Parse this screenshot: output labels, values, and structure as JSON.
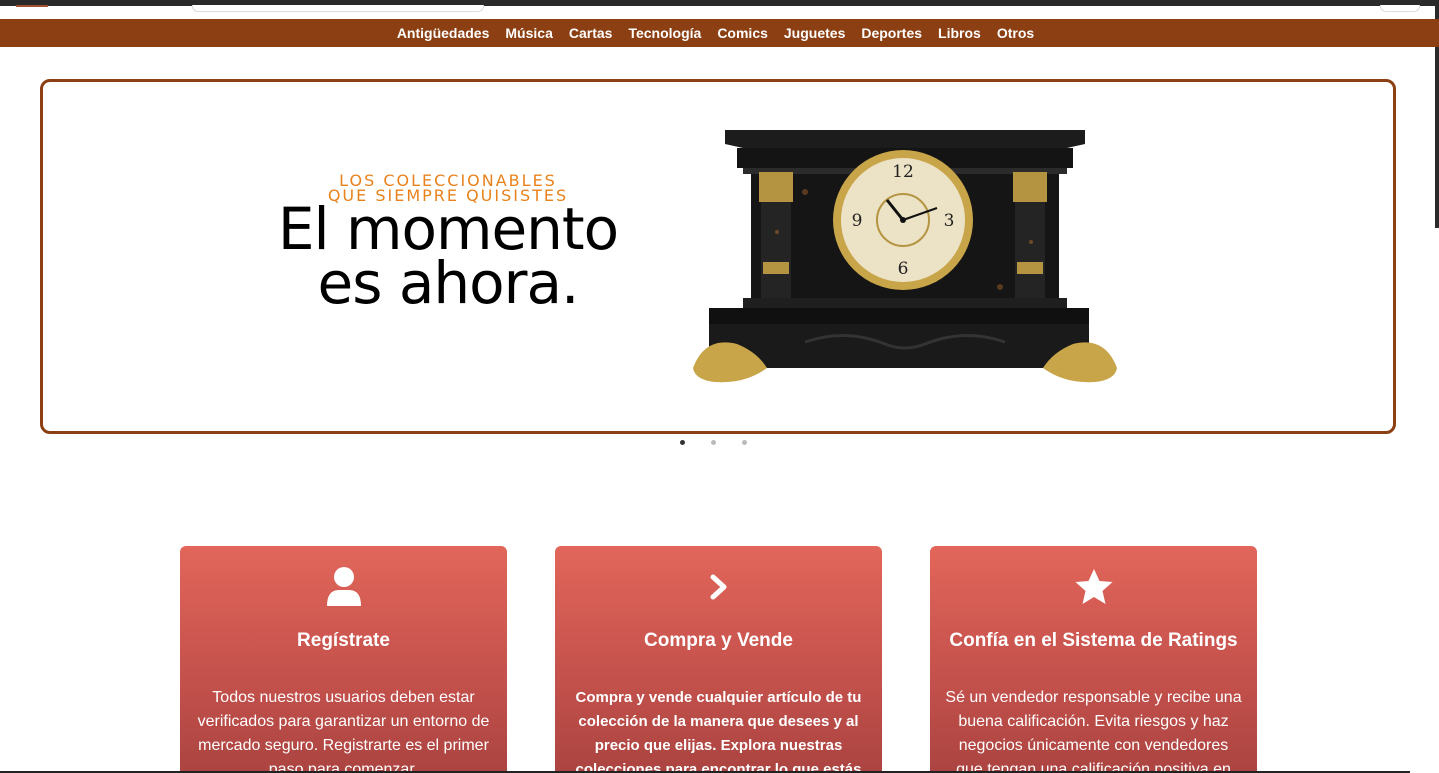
{
  "categories": [
    "Antigüedades",
    "Música",
    "Cartas",
    "Tecnología",
    "Comics",
    "Juguetes",
    "Deportes",
    "Libros",
    "Otros"
  ],
  "hero": {
    "kicker_line1": "LOS COLECCIONABLES",
    "kicker_line2": "QUE SIEMPRE QUISISTES",
    "headline_line1": "El momento",
    "headline_line2": "es ahora.",
    "image": "mantel-clock-image"
  },
  "carousel": {
    "slides": 3,
    "active": 1
  },
  "cards": [
    {
      "icon": "user-icon",
      "title": "Regístrate",
      "text": "Todos nuestros usuarios deben estar verificados para garantizar un entorno de mercado seguro. Registrarte es el primer paso para comenzar."
    },
    {
      "icon": "chevron-right-icon",
      "title": "Compra y Vende",
      "text": "Compra y vende cualquier artículo de tu colección de la manera que desees y al precio que elijas. Explora nuestras colecciones para encontrar lo que estás"
    },
    {
      "icon": "star-icon",
      "title": "Confía en el Sistema de Ratings",
      "text": "Sé un vendedor responsable y recibe una buena calificación. Evita riesgos y haz negocios únicamente con vendedores que tengan una calificación positiva en"
    }
  ],
  "colors": {
    "brand": "#8b3f12",
    "accent": "#e8821c",
    "card": "#d95f55"
  }
}
